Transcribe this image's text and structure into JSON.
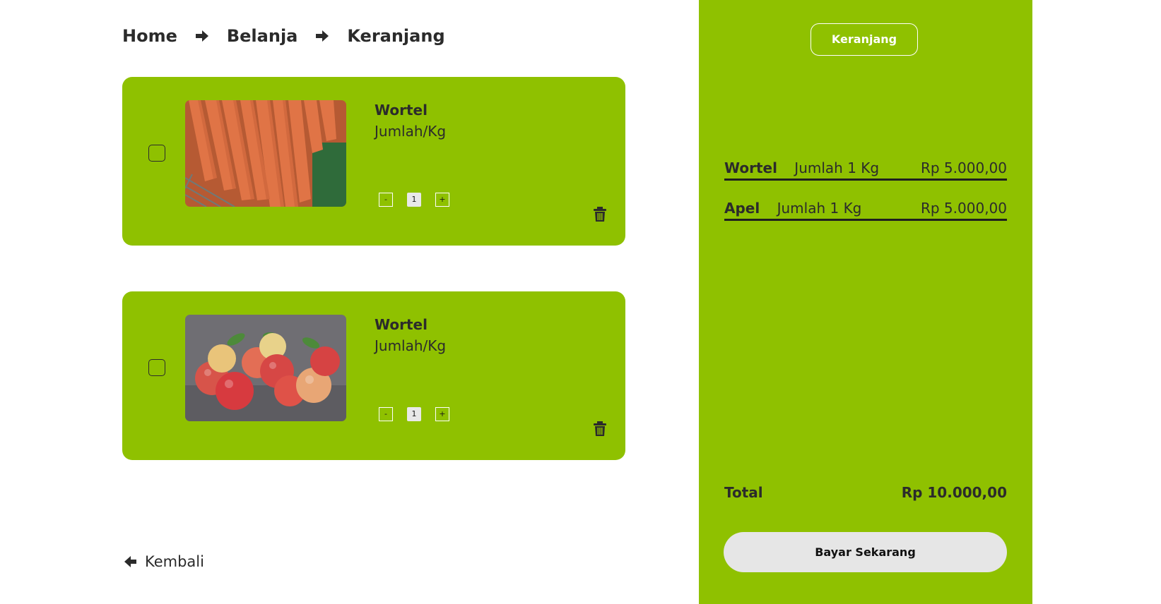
{
  "breadcrumb": {
    "items": [
      "Home",
      "Belanja",
      "Keranjang"
    ]
  },
  "cart": {
    "items": [
      {
        "name": "Wortel",
        "unit": "Jumlah/Kg",
        "qty": "1",
        "minus": "-",
        "plus": "+",
        "image": "carrots"
      },
      {
        "name": "Wortel",
        "unit": "Jumlah/Kg",
        "qty": "1",
        "minus": "-",
        "plus": "+",
        "image": "apples"
      }
    ]
  },
  "back": {
    "label": "Kembali"
  },
  "summary": {
    "title": "Keranjang",
    "rows": [
      {
        "name": "Wortel",
        "amount": "Jumlah 1 Kg",
        "price": "Rp 5.000,00"
      },
      {
        "name": "Apel",
        "amount": "Jumlah 1 Kg",
        "price": "Rp 5.000,00"
      }
    ],
    "total_label": "Total",
    "total_value": "Rp 10.000,00",
    "pay_label": "Bayar Sekarang"
  },
  "colors": {
    "accent": "#8fc100",
    "text": "#2b2b2b",
    "button_bg": "#e6e6e6"
  },
  "icons": {
    "breadcrumb_separator": "arrow-right-icon",
    "back": "arrow-left-icon",
    "delete": "trash-icon"
  }
}
